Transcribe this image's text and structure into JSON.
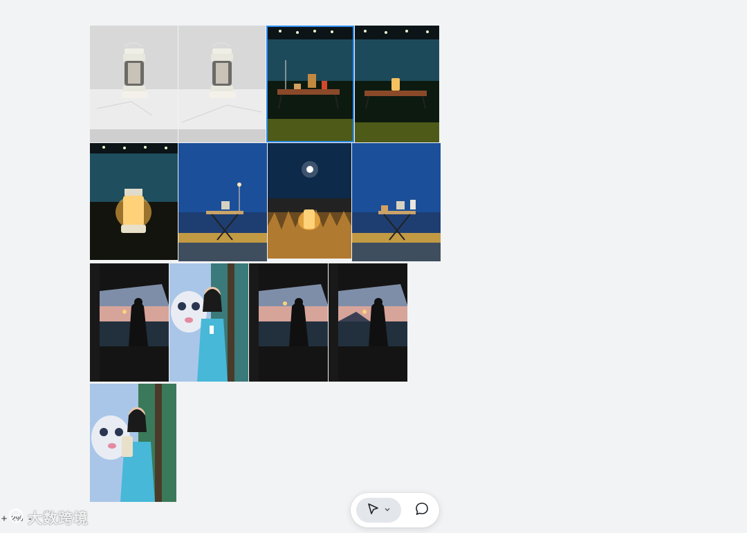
{
  "canvas": {
    "images": [
      {
        "name": "lantern-white-bg-1",
        "selected": false
      },
      {
        "name": "lantern-white-bg-2",
        "selected": false
      },
      {
        "name": "lantern-table-night-lake",
        "selected": true
      },
      {
        "name": "lantern-table-night-lake-2",
        "selected": false
      },
      {
        "name": "lantern-closeup-night",
        "selected": false
      },
      {
        "name": "table-beach-blue-hour",
        "selected": false
      },
      {
        "name": "lantern-grass-moon",
        "selected": false
      },
      {
        "name": "table-beach-blue-hour-2",
        "selected": false
      },
      {
        "name": "silhouette-lantern-sunset-1",
        "selected": false
      },
      {
        "name": "woman-blue-dress-mascot",
        "selected": false
      },
      {
        "name": "silhouette-lantern-sunset-2",
        "selected": false
      },
      {
        "name": "silhouette-lantern-sunset-3",
        "selected": false
      },
      {
        "name": "woman-holding-lantern-mascot",
        "selected": false
      }
    ]
  },
  "toolbar": {
    "select_tool_icon": "cursor-arrow-icon",
    "dropdown_icon": "chevron-down-icon",
    "comment_tool_icon": "comment-bubble-icon",
    "active_tool": "select"
  },
  "zoom": {
    "plus_label": "+",
    "value": "2%",
    "minus_label": "-"
  },
  "watermark": {
    "text": "大数跨境"
  },
  "colors": {
    "background": "#f2f3f5",
    "selection": "#2f8cf0"
  }
}
